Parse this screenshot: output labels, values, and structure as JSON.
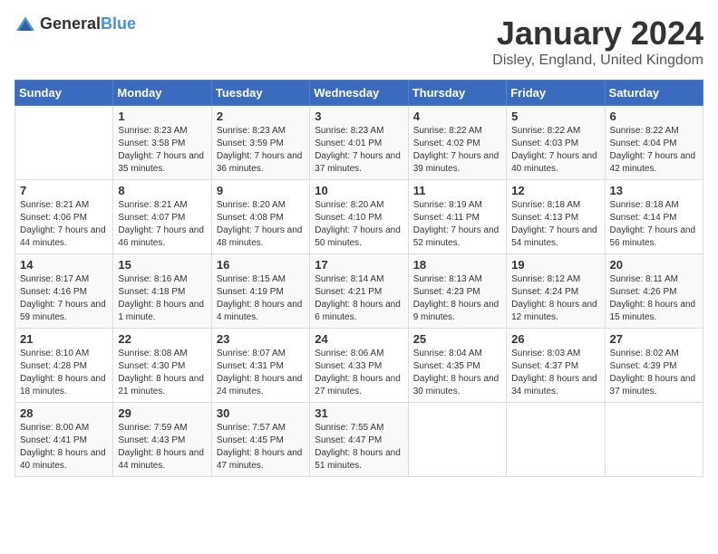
{
  "header": {
    "logo_general": "General",
    "logo_blue": "Blue",
    "month_title": "January 2024",
    "location": "Disley, England, United Kingdom"
  },
  "weekdays": [
    "Sunday",
    "Monday",
    "Tuesday",
    "Wednesday",
    "Thursday",
    "Friday",
    "Saturday"
  ],
  "weeks": [
    [
      {
        "day": "",
        "sunrise": "",
        "sunset": "",
        "daylight": ""
      },
      {
        "day": "1",
        "sunrise": "Sunrise: 8:23 AM",
        "sunset": "Sunset: 3:58 PM",
        "daylight": "Daylight: 7 hours and 35 minutes."
      },
      {
        "day": "2",
        "sunrise": "Sunrise: 8:23 AM",
        "sunset": "Sunset: 3:59 PM",
        "daylight": "Daylight: 7 hours and 36 minutes."
      },
      {
        "day": "3",
        "sunrise": "Sunrise: 8:23 AM",
        "sunset": "Sunset: 4:01 PM",
        "daylight": "Daylight: 7 hours and 37 minutes."
      },
      {
        "day": "4",
        "sunrise": "Sunrise: 8:22 AM",
        "sunset": "Sunset: 4:02 PM",
        "daylight": "Daylight: 7 hours and 39 minutes."
      },
      {
        "day": "5",
        "sunrise": "Sunrise: 8:22 AM",
        "sunset": "Sunset: 4:03 PM",
        "daylight": "Daylight: 7 hours and 40 minutes."
      },
      {
        "day": "6",
        "sunrise": "Sunrise: 8:22 AM",
        "sunset": "Sunset: 4:04 PM",
        "daylight": "Daylight: 7 hours and 42 minutes."
      }
    ],
    [
      {
        "day": "7",
        "sunrise": "Sunrise: 8:21 AM",
        "sunset": "Sunset: 4:06 PM",
        "daylight": "Daylight: 7 hours and 44 minutes."
      },
      {
        "day": "8",
        "sunrise": "Sunrise: 8:21 AM",
        "sunset": "Sunset: 4:07 PM",
        "daylight": "Daylight: 7 hours and 46 minutes."
      },
      {
        "day": "9",
        "sunrise": "Sunrise: 8:20 AM",
        "sunset": "Sunset: 4:08 PM",
        "daylight": "Daylight: 7 hours and 48 minutes."
      },
      {
        "day": "10",
        "sunrise": "Sunrise: 8:20 AM",
        "sunset": "Sunset: 4:10 PM",
        "daylight": "Daylight: 7 hours and 50 minutes."
      },
      {
        "day": "11",
        "sunrise": "Sunrise: 8:19 AM",
        "sunset": "Sunset: 4:11 PM",
        "daylight": "Daylight: 7 hours and 52 minutes."
      },
      {
        "day": "12",
        "sunrise": "Sunrise: 8:18 AM",
        "sunset": "Sunset: 4:13 PM",
        "daylight": "Daylight: 7 hours and 54 minutes."
      },
      {
        "day": "13",
        "sunrise": "Sunrise: 8:18 AM",
        "sunset": "Sunset: 4:14 PM",
        "daylight": "Daylight: 7 hours and 56 minutes."
      }
    ],
    [
      {
        "day": "14",
        "sunrise": "Sunrise: 8:17 AM",
        "sunset": "Sunset: 4:16 PM",
        "daylight": "Daylight: 7 hours and 59 minutes."
      },
      {
        "day": "15",
        "sunrise": "Sunrise: 8:16 AM",
        "sunset": "Sunset: 4:18 PM",
        "daylight": "Daylight: 8 hours and 1 minute."
      },
      {
        "day": "16",
        "sunrise": "Sunrise: 8:15 AM",
        "sunset": "Sunset: 4:19 PM",
        "daylight": "Daylight: 8 hours and 4 minutes."
      },
      {
        "day": "17",
        "sunrise": "Sunrise: 8:14 AM",
        "sunset": "Sunset: 4:21 PM",
        "daylight": "Daylight: 8 hours and 6 minutes."
      },
      {
        "day": "18",
        "sunrise": "Sunrise: 8:13 AM",
        "sunset": "Sunset: 4:23 PM",
        "daylight": "Daylight: 8 hours and 9 minutes."
      },
      {
        "day": "19",
        "sunrise": "Sunrise: 8:12 AM",
        "sunset": "Sunset: 4:24 PM",
        "daylight": "Daylight: 8 hours and 12 minutes."
      },
      {
        "day": "20",
        "sunrise": "Sunrise: 8:11 AM",
        "sunset": "Sunset: 4:26 PM",
        "daylight": "Daylight: 8 hours and 15 minutes."
      }
    ],
    [
      {
        "day": "21",
        "sunrise": "Sunrise: 8:10 AM",
        "sunset": "Sunset: 4:28 PM",
        "daylight": "Daylight: 8 hours and 18 minutes."
      },
      {
        "day": "22",
        "sunrise": "Sunrise: 8:08 AM",
        "sunset": "Sunset: 4:30 PM",
        "daylight": "Daylight: 8 hours and 21 minutes."
      },
      {
        "day": "23",
        "sunrise": "Sunrise: 8:07 AM",
        "sunset": "Sunset: 4:31 PM",
        "daylight": "Daylight: 8 hours and 24 minutes."
      },
      {
        "day": "24",
        "sunrise": "Sunrise: 8:06 AM",
        "sunset": "Sunset: 4:33 PM",
        "daylight": "Daylight: 8 hours and 27 minutes."
      },
      {
        "day": "25",
        "sunrise": "Sunrise: 8:04 AM",
        "sunset": "Sunset: 4:35 PM",
        "daylight": "Daylight: 8 hours and 30 minutes."
      },
      {
        "day": "26",
        "sunrise": "Sunrise: 8:03 AM",
        "sunset": "Sunset: 4:37 PM",
        "daylight": "Daylight: 8 hours and 34 minutes."
      },
      {
        "day": "27",
        "sunrise": "Sunrise: 8:02 AM",
        "sunset": "Sunset: 4:39 PM",
        "daylight": "Daylight: 8 hours and 37 minutes."
      }
    ],
    [
      {
        "day": "28",
        "sunrise": "Sunrise: 8:00 AM",
        "sunset": "Sunset: 4:41 PM",
        "daylight": "Daylight: 8 hours and 40 minutes."
      },
      {
        "day": "29",
        "sunrise": "Sunrise: 7:59 AM",
        "sunset": "Sunset: 4:43 PM",
        "daylight": "Daylight: 8 hours and 44 minutes."
      },
      {
        "day": "30",
        "sunrise": "Sunrise: 7:57 AM",
        "sunset": "Sunset: 4:45 PM",
        "daylight": "Daylight: 8 hours and 47 minutes."
      },
      {
        "day": "31",
        "sunrise": "Sunrise: 7:55 AM",
        "sunset": "Sunset: 4:47 PM",
        "daylight": "Daylight: 8 hours and 51 minutes."
      },
      {
        "day": "",
        "sunrise": "",
        "sunset": "",
        "daylight": ""
      },
      {
        "day": "",
        "sunrise": "",
        "sunset": "",
        "daylight": ""
      },
      {
        "day": "",
        "sunrise": "",
        "sunset": "",
        "daylight": ""
      }
    ]
  ]
}
